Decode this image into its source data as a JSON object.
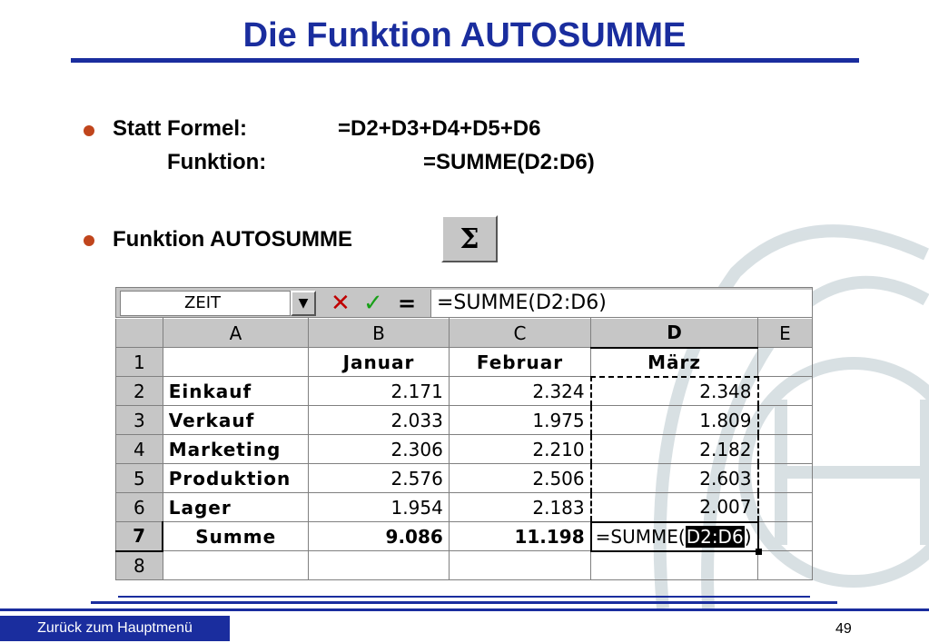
{
  "slide": {
    "title": "Die Funktion AUTOSUMME",
    "bullet1": {
      "label": "Statt Formel:",
      "formula": "=D2+D3+D4+D5+D6",
      "sub_label": "Funktion:",
      "sub_formula": "=SUMME(D2:D6)"
    },
    "bullet2": {
      "label": "Funktion AUTOSUMME",
      "button_symbol": "Σ"
    },
    "colors": {
      "title": "#1a2d9e",
      "bullet": "#c0451c"
    }
  },
  "spreadsheet": {
    "name_box": "ZEIT",
    "cancel_symbol": "✕",
    "confirm_symbol": "✓",
    "equals_symbol": "=",
    "formula_bar": "=SUMME(D2:D6)",
    "columns": [
      "A",
      "B",
      "C",
      "D",
      "E"
    ],
    "row_numbers": [
      "1",
      "2",
      "3",
      "4",
      "5",
      "6",
      "7",
      "8"
    ],
    "rows": [
      {
        "a": "",
        "b": "Januar",
        "c": "Februar",
        "d": "März"
      },
      {
        "a": "Einkauf",
        "b": "2.171",
        "c": "2.324",
        "d": "2.348"
      },
      {
        "a": "Verkauf",
        "b": "2.033",
        "c": "1.975",
        "d": "1.809"
      },
      {
        "a": "Marketing",
        "b": "2.306",
        "c": "2.210",
        "d": "2.182"
      },
      {
        "a": "Produktion",
        "b": "2.576",
        "c": "2.506",
        "d": "2.603"
      },
      {
        "a": "Lager",
        "b": "1.954",
        "c": "2.183",
        "d": "2.007"
      },
      {
        "a": "Summe",
        "b": "9.086",
        "c": "11.198",
        "d_prefix": "=SUMME(",
        "d_selected": "D2:D6",
        "d_suffix": ")"
      }
    ]
  },
  "footer": {
    "back_link": "Zurück zum Hauptmenü",
    "page_number": "49"
  }
}
